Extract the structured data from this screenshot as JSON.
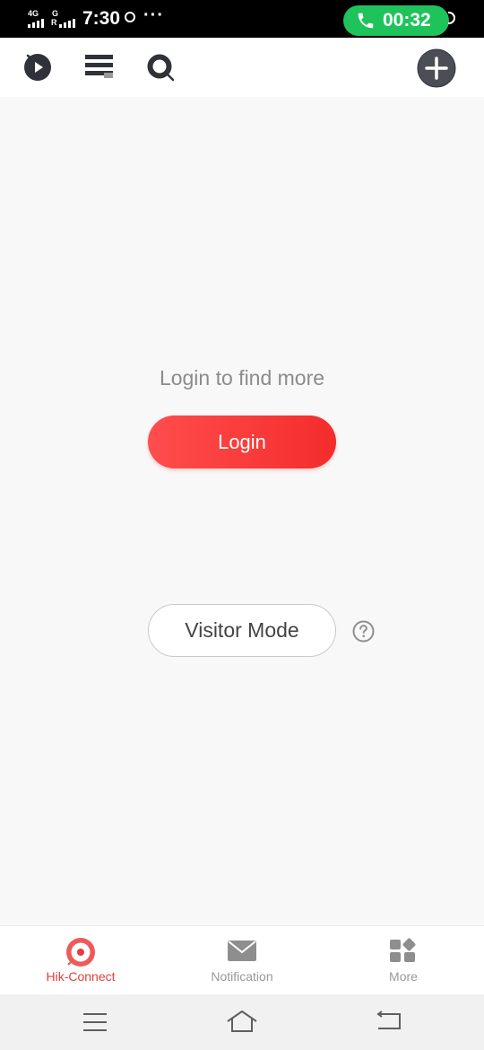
{
  "status_bar": {
    "network_1": "4G",
    "network_2": "G",
    "network_2_sub": "R",
    "time": "7:30",
    "more_indicator": "···",
    "call_timer": "00:32",
    "call_color": "#1fc35b"
  },
  "toolbar": {
    "icons": [
      "playback-icon",
      "list-view-icon",
      "search-icon",
      "add-device-icon"
    ]
  },
  "main": {
    "prompt": "Login to find more",
    "login_label": "Login",
    "visitor_label": "Visitor Mode",
    "accent_color": "#f43535"
  },
  "bottom_nav": {
    "items": [
      {
        "label": "Hik-Connect",
        "icon": "hik-connect-icon",
        "active": true
      },
      {
        "label": "Notification",
        "icon": "mail-icon",
        "active": false
      },
      {
        "label": "More",
        "icon": "more-grid-icon",
        "active": false
      }
    ]
  },
  "system_nav": {
    "icons": [
      "menu-icon",
      "home-icon",
      "back-icon"
    ]
  }
}
